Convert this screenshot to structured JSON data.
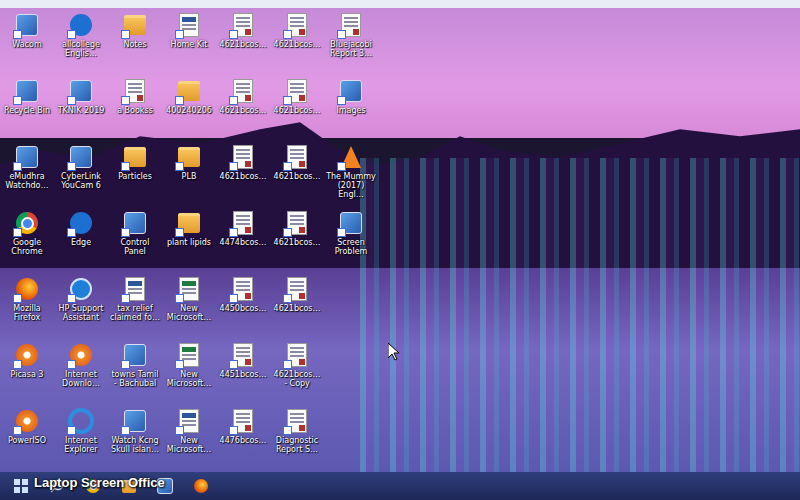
{
  "desktop": {
    "icons": [
      {
        "label": "Wacom",
        "kind": "app"
      },
      {
        "label": "Recycle Bin",
        "kind": "app"
      },
      {
        "label": "eMudhra Watchdo…",
        "kind": "app"
      },
      {
        "label": "Google Chrome",
        "kind": "chrome"
      },
      {
        "label": "Mozilla Firefox",
        "kind": "firefox"
      },
      {
        "label": "Picasa 3",
        "kind": "disc"
      },
      {
        "label": "PowerISO",
        "kind": "disc"
      },
      {
        "label": "allcollege Englis…",
        "kind": "edge"
      },
      {
        "label": "TKNIK 2019",
        "kind": "app"
      },
      {
        "label": "CyberLink YouCam 6",
        "kind": "app"
      },
      {
        "label": "Edge",
        "kind": "edge"
      },
      {
        "label": "HP Support Assistant",
        "kind": "help"
      },
      {
        "label": "Internet Downlo…",
        "kind": "disc"
      },
      {
        "label": "Internet Explorer",
        "kind": "ie"
      },
      {
        "label": "Notes",
        "kind": "folder"
      },
      {
        "label": "a Bookss",
        "kind": "doc"
      },
      {
        "label": "Particles",
        "kind": "folder"
      },
      {
        "label": "Control Panel",
        "kind": "app"
      },
      {
        "label": "tax relief claimed fo…",
        "kind": "word"
      },
      {
        "label": "towns Tamil - Bachubal",
        "kind": "app"
      },
      {
        "label": "Watch Kcng Skull islan…",
        "kind": "app"
      },
      {
        "label": "Home Kit",
        "kind": "word"
      },
      {
        "label": "400240206",
        "kind": "folder"
      },
      {
        "label": "PLB",
        "kind": "folder"
      },
      {
        "label": "plant lipids",
        "kind": "folder"
      },
      {
        "label": "New Microsoft…",
        "kind": "excel"
      },
      {
        "label": "New Microsoft…",
        "kind": "excel"
      },
      {
        "label": "New Microsoft…",
        "kind": "word"
      },
      {
        "label": "4621bcos…",
        "kind": "doc"
      },
      {
        "label": "4621bcos…",
        "kind": "doc"
      },
      {
        "label": "4621bcos…",
        "kind": "doc"
      },
      {
        "label": "4474bcos…",
        "kind": "doc"
      },
      {
        "label": "4450bcos…",
        "kind": "doc"
      },
      {
        "label": "4451bcos…",
        "kind": "doc"
      },
      {
        "label": "4476bcos…",
        "kind": "doc"
      },
      {
        "label": "4621bcos…",
        "kind": "doc"
      },
      {
        "label": "4621bcos…",
        "kind": "doc"
      },
      {
        "label": "4621bcos…",
        "kind": "doc"
      },
      {
        "label": "4621bcos…",
        "kind": "doc"
      },
      {
        "label": "4621bcos…",
        "kind": "doc"
      },
      {
        "label": "4621bcos… - Copy",
        "kind": "doc"
      },
      {
        "label": "Diagnostic Report S…",
        "kind": "doc"
      },
      {
        "label": "Bluejacobi Report 3…",
        "kind": "doc"
      },
      {
        "label": "Images",
        "kind": "app"
      },
      {
        "label": "The Mummy (2017) Engl…",
        "kind": "vlc"
      },
      {
        "label": "Screen Problem",
        "kind": "app"
      }
    ]
  },
  "taskbar": {
    "items": [
      {
        "kind": "start"
      },
      {
        "kind": "search"
      },
      {
        "kind": "chrome"
      },
      {
        "kind": "folder"
      },
      {
        "kind": "app"
      },
      {
        "kind": "firefox"
      }
    ]
  },
  "watermark": "Laptop Screen Office"
}
